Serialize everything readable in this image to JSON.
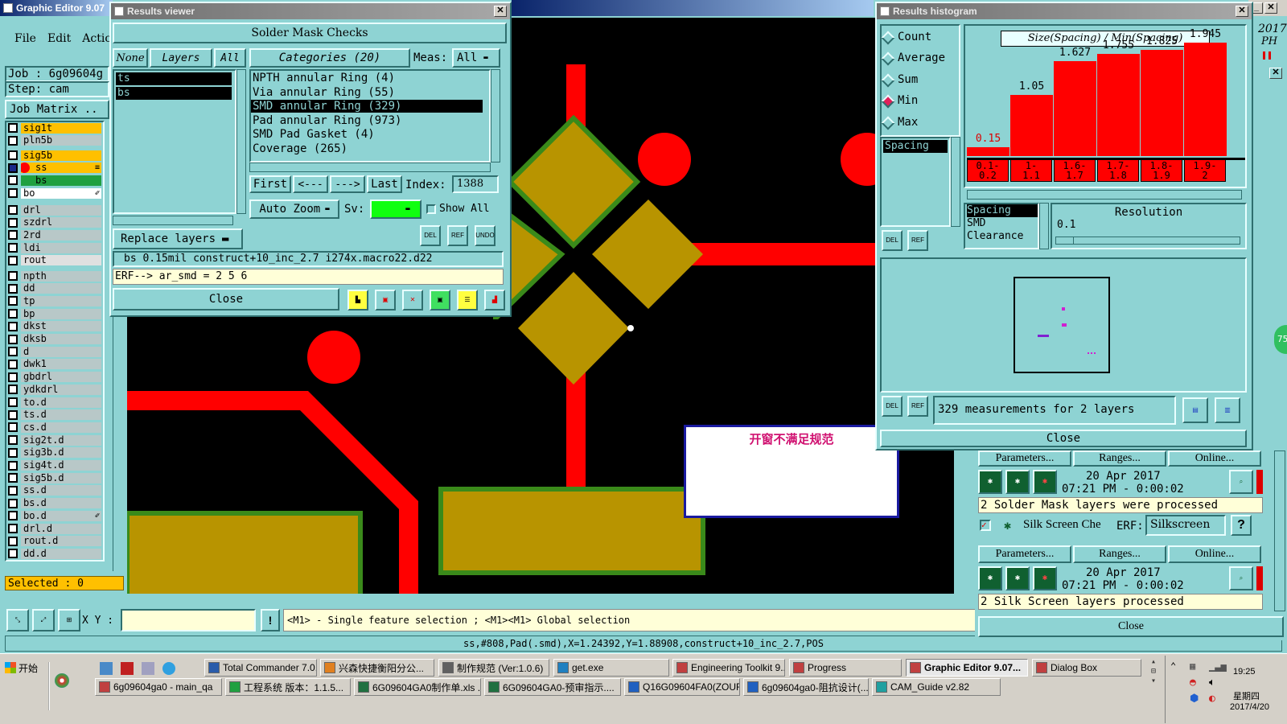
{
  "main_window": {
    "title": "Graphic Editor 9.07",
    "menu": [
      "File",
      "Edit",
      "Actio"
    ],
    "job_label": "Job : 6g09604g",
    "step_label": "Step: cam",
    "job_matrix_btn": "Job Matrix ..",
    "year_readout": "2017",
    "ph_readout": "PH",
    "selected_label": "Selected : 0",
    "xy_label": "X Y :",
    "xy_value": "",
    "mouse_hint": "<M1> - Single feature selection ; <M1><M1> Global selection",
    "status_line": "ss,#808,Pad(.smd),X=1.24392,Y=1.88908,construct+10_inc_2.7,POS",
    "popup_text": "开窗不满足规范",
    "green_badge": "75"
  },
  "layers": [
    {
      "name": "sig1t",
      "color": "#ffc000"
    },
    {
      "name": "pln5b",
      "color": "#b8c8c8"
    },
    {
      "name": "sig5b",
      "color": "#ffc000"
    },
    {
      "name": "ss",
      "color": "#ffc000",
      "dot": "#ff0000",
      "mark": "≡",
      "checked": true
    },
    {
      "name": "bs",
      "color": "#20a040",
      "dot": "#20a040"
    },
    {
      "name": "bo",
      "color": "#ffffff",
      "mark": "✐"
    },
    {
      "name": "drl",
      "color": "#b8c8c8"
    },
    {
      "name": "szdrl",
      "color": "#b8c8c8"
    },
    {
      "name": "2rd",
      "color": "#b8c8c8"
    },
    {
      "name": "ldi",
      "color": "#b8c8c8"
    },
    {
      "name": "rout",
      "color": "#e0e0e0"
    },
    {
      "name": "npth",
      "color": "#b8c8c8"
    },
    {
      "name": "dd",
      "color": "#b8c8c8"
    },
    {
      "name": "tp",
      "color": "#b8c8c8"
    },
    {
      "name": "bp",
      "color": "#b8c8c8"
    },
    {
      "name": "dkst",
      "color": "#b8c8c8"
    },
    {
      "name": "dksb",
      "color": "#b8c8c8"
    },
    {
      "name": "d",
      "color": "#b8c8c8"
    },
    {
      "name": "dwk1",
      "color": "#b8c8c8"
    },
    {
      "name": "gbdrl",
      "color": "#b8c8c8"
    },
    {
      "name": "ydkdrl",
      "color": "#b8c8c8"
    },
    {
      "name": "to.d",
      "color": "#b8c8c8"
    },
    {
      "name": "ts.d",
      "color": "#b8c8c8"
    },
    {
      "name": "cs.d",
      "color": "#b8c8c8"
    },
    {
      "name": "sig2t.d",
      "color": "#b8c8c8"
    },
    {
      "name": "sig3b.d",
      "color": "#b8c8c8"
    },
    {
      "name": "sig4t.d",
      "color": "#b8c8c8"
    },
    {
      "name": "sig5b.d",
      "color": "#b8c8c8"
    },
    {
      "name": "ss.d",
      "color": "#b8c8c8"
    },
    {
      "name": "bs.d",
      "color": "#b8c8c8"
    },
    {
      "name": "bo.d",
      "color": "#b8c8c8",
      "mark": "✐"
    },
    {
      "name": "drl.d",
      "color": "#b8c8c8"
    },
    {
      "name": "rout.d",
      "color": "#b8c8c8"
    },
    {
      "name": "dd.d",
      "color": "#b8c8c8"
    }
  ],
  "results_viewer": {
    "title": "Results viewer",
    "header": "Solder Mask Checks",
    "none_btn": "None",
    "layers_btn": "Layers",
    "all_btn": "All",
    "layer_list": [
      "ts",
      "bs"
    ],
    "categories_btn": "Categories (20)",
    "meas_label": "Meas:",
    "meas_value": "All",
    "categories": [
      "NPTH annular Ring (4)",
      "Via annular Ring (55)",
      "SMD annular Ring (329)",
      "Pad annular Ring (973)",
      "SMD Pad Gasket (4)",
      "Coverage (265)"
    ],
    "selected_category": 2,
    "first_btn": "First",
    "prev_btn": "<---",
    "next_btn": "--->",
    "last_btn": "Last",
    "index_label": "Index:",
    "index_value": "1388",
    "auto_zoom": "Auto Zoom",
    "sv_label": "Sv:",
    "show_all": "Show All",
    "replace_layers": "Replace layers",
    "del": "DEL",
    "ref": "REF",
    "undo": "UNDO",
    "info_line": "bs 0.15mil  construct+10_inc_2.7  i274x.macro22.d22",
    "erf_line": "ERF--> ar_smd = 2 5 6",
    "close": "Close"
  },
  "histogram": {
    "title": "Results histogram",
    "modes": [
      "Count",
      "Average",
      "Sum",
      "Min",
      "Max"
    ],
    "selected_mode": "Min",
    "spacing_tag": "Spacing",
    "chart_title": "Size(Spacing) / Min(Spacing)",
    "res_list": [
      "Spacing",
      "SMD",
      "Clearance"
    ],
    "resolution_label": "Resolution",
    "resolution_value": "0.1",
    "measure_text": "329 measurements for 2 layers",
    "close": "Close"
  },
  "chart_data": {
    "type": "bar",
    "title": "Size(Spacing) / Min(Spacing)",
    "categories": [
      "0.1-0.2",
      "1-1.1",
      "1.6-1.7",
      "1.7-1.8",
      "1.8-1.9",
      "1.9-2"
    ],
    "tick_labels": [
      [
        "0.1-",
        "0.2"
      ],
      [
        "1-",
        "1.1"
      ],
      [
        "1.6-",
        "1.7"
      ],
      [
        "1.7-",
        "1.8"
      ],
      [
        "1.8-",
        "1.9"
      ],
      [
        "1.9-",
        "2"
      ]
    ],
    "value_labels": [
      "0.15",
      "1.05",
      "1.627",
      "1.755",
      "1.825",
      "1.945"
    ],
    "values": [
      0.15,
      1.05,
      1.627,
      1.755,
      1.825,
      1.945
    ],
    "ylim": [
      0,
      2.2
    ],
    "bar_color": "#ff0000"
  },
  "checklist": {
    "params": "Parameters...",
    "ranges": "Ranges...",
    "online": "Online...",
    "date1": "20 Apr 2017",
    "time1": "07:21 PM - 0:00:02",
    "msg1": "2 Solder Mask layers were processed",
    "silk_label": "Silk Screen Che",
    "erf_label": "ERF:",
    "erf_value": "Silkscreen",
    "help": "?",
    "date2": "20 Apr 2017",
    "time2": "07:21 PM - 0:00:02",
    "msg2": "2 Silk Screen layers processed",
    "close": "Close"
  },
  "taskbar": {
    "start": "开始",
    "row1": [
      {
        "label": "Total Commander 7.0...",
        "icon": "#2a5caa"
      },
      {
        "label": "兴森快捷衡阳分公...",
        "icon": "#e08020"
      },
      {
        "label": "制作规范 (Ver:1.0.6)",
        "icon": "#606060"
      },
      {
        "label": "get.exe",
        "icon": "#2080c0"
      },
      {
        "label": "Engineering Toolkit 9....",
        "icon": "#c04040"
      },
      {
        "label": "Progress",
        "icon": "#c04040"
      },
      {
        "label": "Graphic Editor 9.07...",
        "icon": "#c04040",
        "active": true
      },
      {
        "label": "Dialog Box",
        "icon": "#c04040"
      }
    ],
    "row2": [
      {
        "label": "6g09604ga0 - main_qa",
        "icon": "#c04040"
      },
      {
        "label": "工程系统  版本：1.1.5...",
        "icon": "#20a040"
      },
      {
        "label": "6G09604GA0制作单.xls ...",
        "icon": "#207040"
      },
      {
        "label": "6G09604GA0-预审指示....",
        "icon": "#207040"
      },
      {
        "label": "Q16G09604FA0(ZOUFEN...",
        "icon": "#2060c0"
      },
      {
        "label": "6g09604ga0-阻抗设计(...",
        "icon": "#2060c0"
      },
      {
        "label": "CAM_Guide v2.82",
        "icon": "#20a0a0"
      }
    ],
    "time": "19:25",
    "weekday": "星期四",
    "date": "2017/4/20"
  }
}
